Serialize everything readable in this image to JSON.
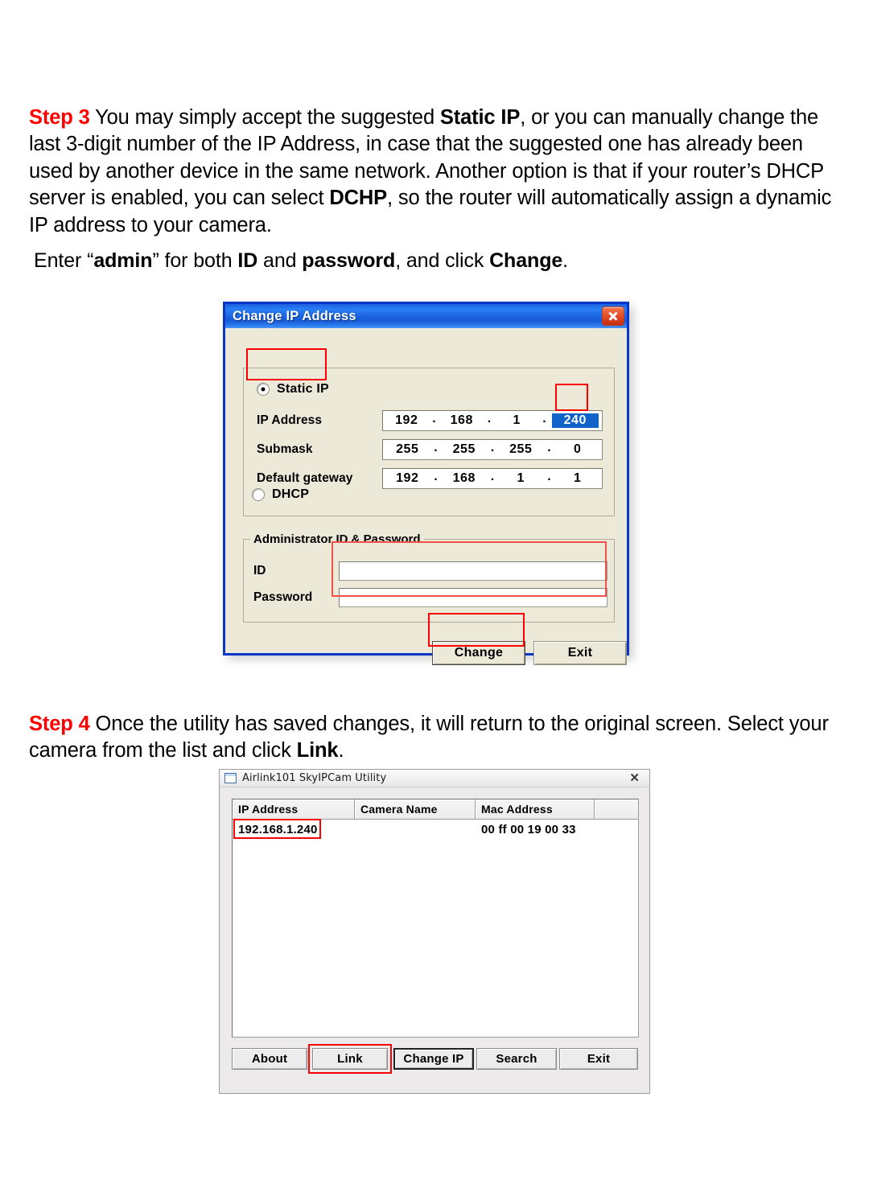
{
  "step3": {
    "label": "Step 3",
    "text_parts": [
      {
        "t": " You may simply accept the suggested ",
        "bold": false
      },
      {
        "t": "Static IP",
        "bold": true
      },
      {
        "t": ", or you can manually change the last 3-digit number of the IP Address, in case that the suggested one has already been used by another device in the same network. Another option is that if your router’s DHCP server is enabled, you can select ",
        "bold": false
      },
      {
        "t": "DCHP",
        "bold": true
      },
      {
        "t": ", so the router will automatically assign a dynamic IP address to your camera.",
        "bold": false
      }
    ],
    "full_text": "Step 3 You may simply accept the suggested Static IP, or you can manually change the last 3-digit number of the IP Address, in case that the suggested one has already been used by another device in the same network. Another option is that if your router’s DHCP server is enabled, you can select DCHP, so the router will automatically assign a dynamic IP address to your camera."
  },
  "subline": {
    "full_text": "Enter “admin” for both ID and password, and click Change.",
    "parts": [
      {
        "t": "Enter “",
        "bold": false
      },
      {
        "t": "admin",
        "bold": true
      },
      {
        "t": "” for both ",
        "bold": false
      },
      {
        "t": "ID",
        "bold": true
      },
      {
        "t": " and ",
        "bold": false
      },
      {
        "t": "password",
        "bold": true
      },
      {
        "t": ", and click ",
        "bold": false
      },
      {
        "t": "Change",
        "bold": true
      },
      {
        "t": ".",
        "bold": false
      }
    ]
  },
  "step4": {
    "label": "Step 4",
    "full_text": "Step 4 Once the utility has saved changes, it will return to the original screen. Select your camera from the list and click Link.",
    "parts": [
      {
        "t": " Once the utility has saved changes, it will return to the original screen. Select your camera from the list and click ",
        "bold": false
      },
      {
        "t": "Link",
        "bold": true
      },
      {
        "t": ".",
        "bold": false
      }
    ]
  },
  "dialog_change_ip": {
    "title": "Change IP Address",
    "close_icon": "close-icon",
    "mode_static_label": "Static IP",
    "mode_static_checked": true,
    "mode_dhcp_label": "DHCP",
    "mode_dhcp_checked": false,
    "fields": [
      {
        "label": "IP Address",
        "octets": [
          "192",
          "168",
          "1",
          "240"
        ],
        "selected_octet_index": 3
      },
      {
        "label": "Submask",
        "octets": [
          "255",
          "255",
          "255",
          "0"
        ],
        "selected_octet_index": -1
      },
      {
        "label": "Default gateway",
        "octets": [
          "192",
          "168",
          "1",
          "1"
        ],
        "selected_octet_index": -1
      }
    ],
    "dot": ".",
    "admin_group_legend": "Administrator ID & Password",
    "admin_id_label": "ID",
    "admin_id_value": "",
    "admin_password_label": "Password",
    "admin_password_value": "",
    "buttons": {
      "change": "Change",
      "exit": "Exit"
    },
    "colors": {
      "titlebar_blue": "#1c64e0",
      "dialog_face": "#ece9d8",
      "border_blue": "#0a36c8",
      "selection_blue": "#1063c8",
      "annotation_red": "#ff0000"
    }
  },
  "dialog_utility": {
    "title": "Airlink101 SkyIPCam Utility",
    "window_icon": "window-icon",
    "close_icon": "close-icon",
    "columns": [
      "IP Address",
      "Camera Name",
      "Mac Address",
      ""
    ],
    "rows": [
      {
        "ip_address": "192.168.1.240",
        "camera_name": "",
        "mac_address": "00 ff 00 19 00 33",
        "extra": ""
      }
    ],
    "buttons": [
      {
        "id": "about",
        "label": "About",
        "focused": false
      },
      {
        "id": "link",
        "label": "Link",
        "focused": false
      },
      {
        "id": "change-ip",
        "label": "Change IP",
        "focused": true
      },
      {
        "id": "search",
        "label": "Search",
        "focused": false
      },
      {
        "id": "exit",
        "label": "Exit",
        "focused": false
      }
    ],
    "colors": {
      "window_face": "#eceaea",
      "annotation_red": "#ff0000"
    }
  }
}
